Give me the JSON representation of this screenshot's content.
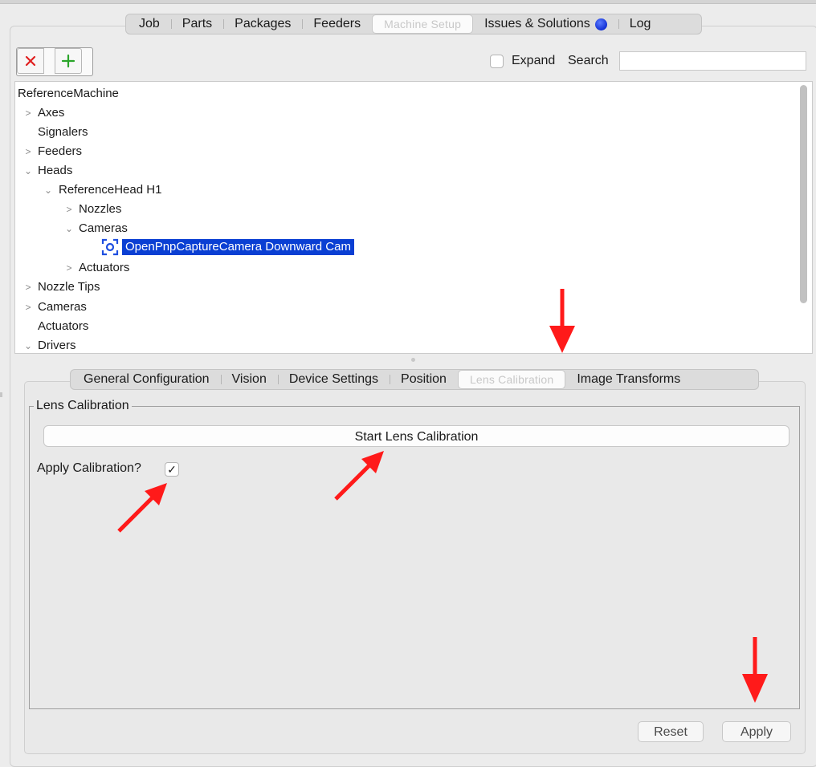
{
  "main_tabs": [
    {
      "label": "Job"
    },
    {
      "label": "Parts"
    },
    {
      "label": "Packages"
    },
    {
      "label": "Feeders"
    },
    {
      "label": "Machine Setup"
    },
    {
      "label": "Issues & Solutions"
    },
    {
      "label": "Log"
    }
  ],
  "main_tabs_selected": "Machine Setup",
  "toolbar": {
    "delete_icon": "close-icon",
    "add_icon": "plus-icon",
    "expand_label": "Expand",
    "expand_checked": false,
    "search_label": "Search",
    "search_value": ""
  },
  "tree": {
    "root": "ReferenceMachine",
    "nodes": [
      {
        "label": "Axes",
        "expander": "collapsed"
      },
      {
        "label": "Signalers",
        "expander": "none"
      },
      {
        "label": "Feeders",
        "expander": "collapsed"
      },
      {
        "label": "Heads",
        "expander": "expanded"
      },
      {
        "label": "ReferenceHead H1",
        "expander": "expanded"
      },
      {
        "label": "Nozzles",
        "expander": "collapsed"
      },
      {
        "label": "Cameras",
        "expander": "expanded"
      },
      {
        "label": "OpenPnpCaptureCamera Downward Cam",
        "expander": "none",
        "selected": true,
        "icon": "camera-icon"
      },
      {
        "label": "Actuators",
        "expander": "collapsed"
      },
      {
        "label": "Nozzle Tips",
        "expander": "collapsed"
      },
      {
        "label": "Cameras",
        "expander": "collapsed"
      },
      {
        "label": "Actuators",
        "expander": "none"
      },
      {
        "label": "Drivers",
        "expander": "expanded"
      }
    ]
  },
  "sub_tabs": [
    {
      "label": "General Configuration"
    },
    {
      "label": "Vision"
    },
    {
      "label": "Device Settings"
    },
    {
      "label": "Position"
    },
    {
      "label": "Lens Calibration"
    },
    {
      "label": "Image Transforms"
    }
  ],
  "sub_tabs_selected": "Lens Calibration",
  "lens_calibration": {
    "legend": "Lens Calibration",
    "start_button": "Start Lens Calibration",
    "apply_label": "Apply Calibration?",
    "apply_checked": true,
    "check_mark": "✓"
  },
  "footer": {
    "reset_label": "Reset",
    "apply_label": "Apply"
  },
  "colors": {
    "selection": "#0a3fd3",
    "annotation_arrow": "#ff1a1a",
    "delete_icon": "#e02020",
    "add_icon": "#2aa52a"
  }
}
